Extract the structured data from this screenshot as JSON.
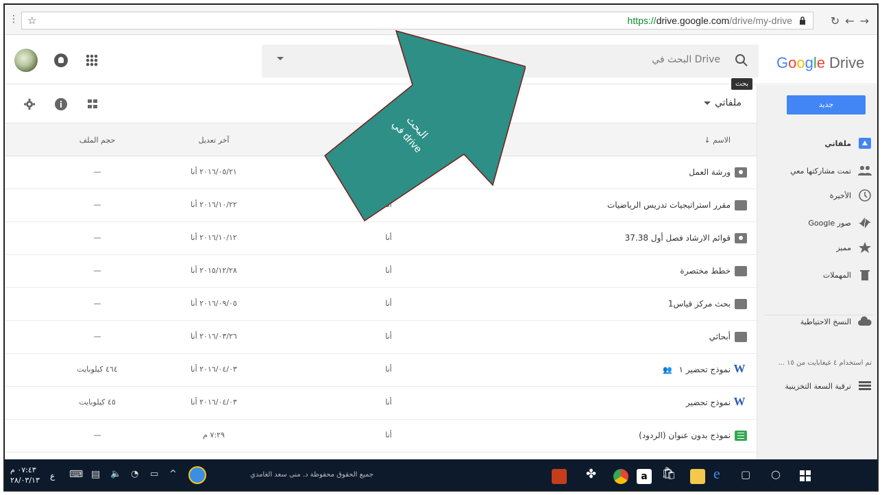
{
  "browser": {
    "url_scheme": "https://",
    "url_host": "drive.google.com",
    "url_path": "/drive/my-drive"
  },
  "header": {
    "search_placeholder": "البحث في Drive",
    "search_tooltip": "بحث",
    "logo_google": [
      "G",
      "o",
      "o",
      "g",
      "l",
      "e"
    ],
    "logo_product": "Drive"
  },
  "toolbar": {
    "location": "ملفاتي",
    "new_button": "جديد"
  },
  "annotation": {
    "arrow_text_1": "البحث",
    "arrow_text_2": "في drive",
    "arrow_color": "#2d8f85"
  },
  "list": {
    "headers": {
      "name": "الاسم",
      "owner": "",
      "modified": "آخر تعديل",
      "size": "حجم الملف"
    },
    "rows": [
      {
        "name": "ورشة العمل",
        "owner": "",
        "modified": "٢٠١٦/٠٥/٢١ أنا",
        "size": "—",
        "icon": "shared-folder"
      },
      {
        "name": "مقرر استراتيجيات تدريس الرياضيات",
        "owner": "أنا",
        "modified": "٢٠١٦/١٠/٢٢ أنا",
        "size": "—",
        "icon": "folder"
      },
      {
        "name": "قوائم الارشاد فصل أول 37.38",
        "owner": "أنا",
        "modified": "٢٠١٦/١٠/١٢ أنا",
        "size": "—",
        "icon": "shared-folder"
      },
      {
        "name": "خطط مختصرة",
        "owner": "أنا",
        "modified": "٢٠١٥/١٢/٢٨ أنا",
        "size": "—",
        "icon": "folder"
      },
      {
        "name": "بحث مركز قياس1",
        "owner": "أنا",
        "modified": "٢٠١٦/٠٩/٠٥ أنا",
        "size": "—",
        "icon": "folder"
      },
      {
        "name": "أبحاثي",
        "owner": "أنا",
        "modified": "٢٠١٦/٠٣/٢٦ أنا",
        "size": "—",
        "icon": "folder"
      },
      {
        "name": "نموذج تحضير ١",
        "owner": "أنا",
        "modified": "٢٠١٦/٠٤/٠٣ أنا",
        "size": "٤٦٤ كيلوبايت",
        "icon": "word",
        "shared": true
      },
      {
        "name": "نموذج تحضير",
        "owner": "أنا",
        "modified": "٢٠١٦/٠٤/٠٣ أنا",
        "size": "٤٥ كيلوبايت",
        "icon": "word"
      },
      {
        "name": "نموذج بدون عنوان (الردود)",
        "owner": "أنا",
        "modified": "٧:٢٩ م",
        "size": "—",
        "icon": "sheet"
      }
    ]
  },
  "sidebar": {
    "items": [
      {
        "label": "ملفاتي",
        "icon": "drive-icon"
      },
      {
        "label": "تمت مشاركتها معي",
        "icon": "people-icon"
      },
      {
        "label": "الأخيرة",
        "icon": "clock-icon"
      },
      {
        "label": "صور Google",
        "icon": "photos-icon"
      },
      {
        "label": "مميز",
        "icon": "star-icon"
      },
      {
        "label": "المهملات",
        "icon": "trash-icon"
      },
      {
        "label": "النسخ الاحتياطية",
        "icon": "cloud-icon"
      }
    ],
    "storage_used": "تم استخدام ٤ غيغابايت من ١٥ ...",
    "upgrade": "ترقية السعة التخزينية"
  },
  "taskbar": {
    "time": "٠٧:٤٣ م",
    "date": "٢٨/٠٣/١٣",
    "lang": "ع",
    "copyright": "جميع الحقوق محفوظة د. منى سعد الغامدي"
  }
}
